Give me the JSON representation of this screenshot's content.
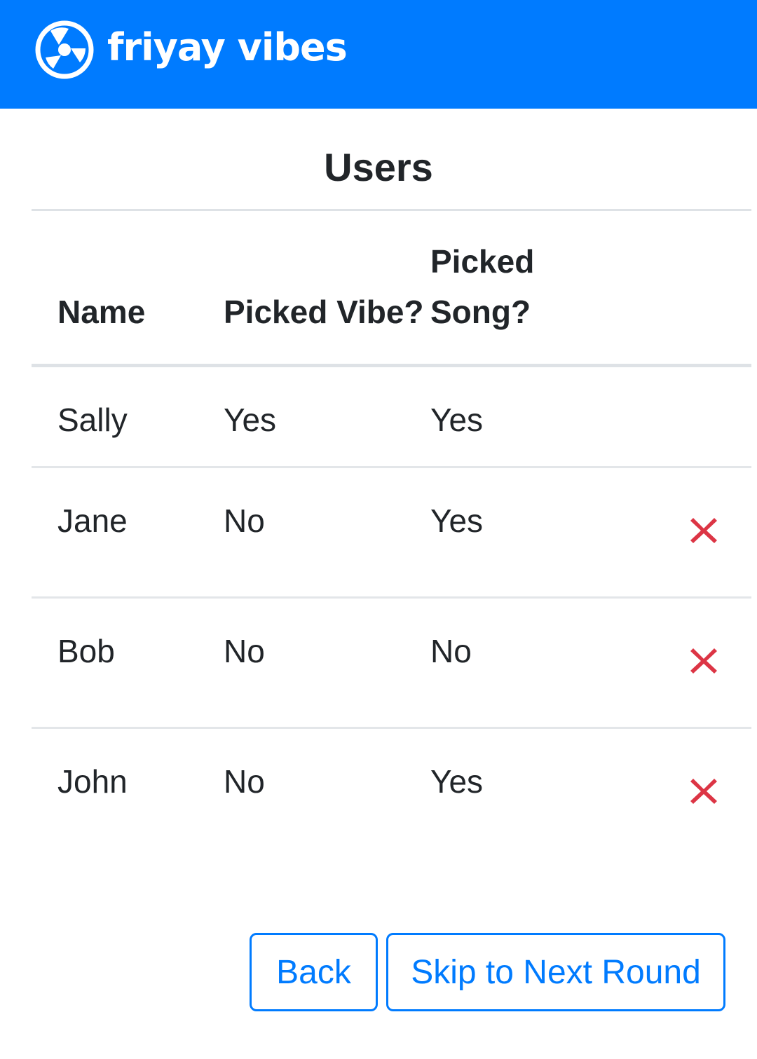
{
  "header": {
    "brand_name": "friyay vibes",
    "logo_icon": "vinyl-record-icon",
    "background_color": "#007bff"
  },
  "page": {
    "title": "Users"
  },
  "table": {
    "columns": [
      "Name",
      "Picked Vibe?",
      "Picked Song?",
      ""
    ],
    "rows": [
      {
        "name": "Sally",
        "picked_vibe": "Yes",
        "picked_song": "Yes",
        "deletable": false
      },
      {
        "name": "Jane",
        "picked_vibe": "No",
        "picked_song": "Yes",
        "deletable": true
      },
      {
        "name": "Bob",
        "picked_vibe": "No",
        "picked_song": "No",
        "deletable": true
      },
      {
        "name": "John",
        "picked_vibe": "No",
        "picked_song": "Yes",
        "deletable": true
      }
    ],
    "delete_icon": "close-icon",
    "delete_icon_color": "#dc3545"
  },
  "actions": {
    "back_label": "Back",
    "skip_label": "Skip to Next Round",
    "button_color": "#007bff"
  }
}
